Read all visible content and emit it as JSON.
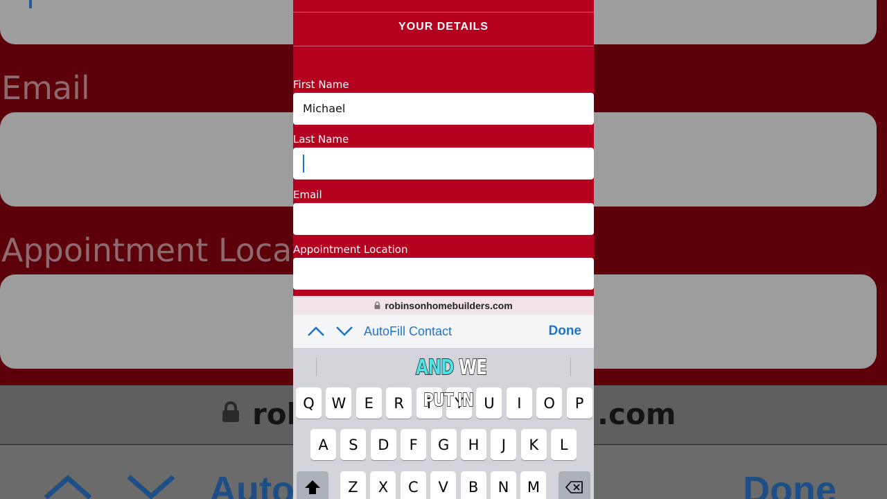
{
  "background": {
    "labels": [
      "Email",
      "Appointment Locat"
    ],
    "url_fragments": [
      "rob",
      ".com"
    ],
    "accessory_fragments": [
      "Auto",
      "Done"
    ]
  },
  "form": {
    "heading": "YOUR DETAILS",
    "fields": [
      {
        "label": "First Name",
        "value": "Michael"
      },
      {
        "label": "Last Name",
        "value": ""
      },
      {
        "label": "Email",
        "value": ""
      },
      {
        "label": "Appointment Location",
        "value": ""
      }
    ]
  },
  "browser": {
    "url": "robinsonhomebuilders.com"
  },
  "accessory": {
    "autofill_label": "AutoFill Contact",
    "done_label": "Done"
  },
  "keyboard": {
    "row1": [
      "Q",
      "W",
      "E",
      "R",
      "T",
      "Y",
      "U",
      "I",
      "O",
      "P"
    ],
    "row2": [
      "A",
      "S",
      "D",
      "F",
      "G",
      "H",
      "J",
      "K",
      "L"
    ],
    "row3": [
      "Z",
      "X",
      "C",
      "V",
      "B",
      "N",
      "M"
    ]
  },
  "caption": {
    "line1_a": "AND",
    "line1_b": "WE",
    "line2": "PUT IN"
  },
  "colors": {
    "brand_red": "#b5001f",
    "link_blue": "#1f73c9",
    "caption_highlight": "#4fe3e8"
  }
}
